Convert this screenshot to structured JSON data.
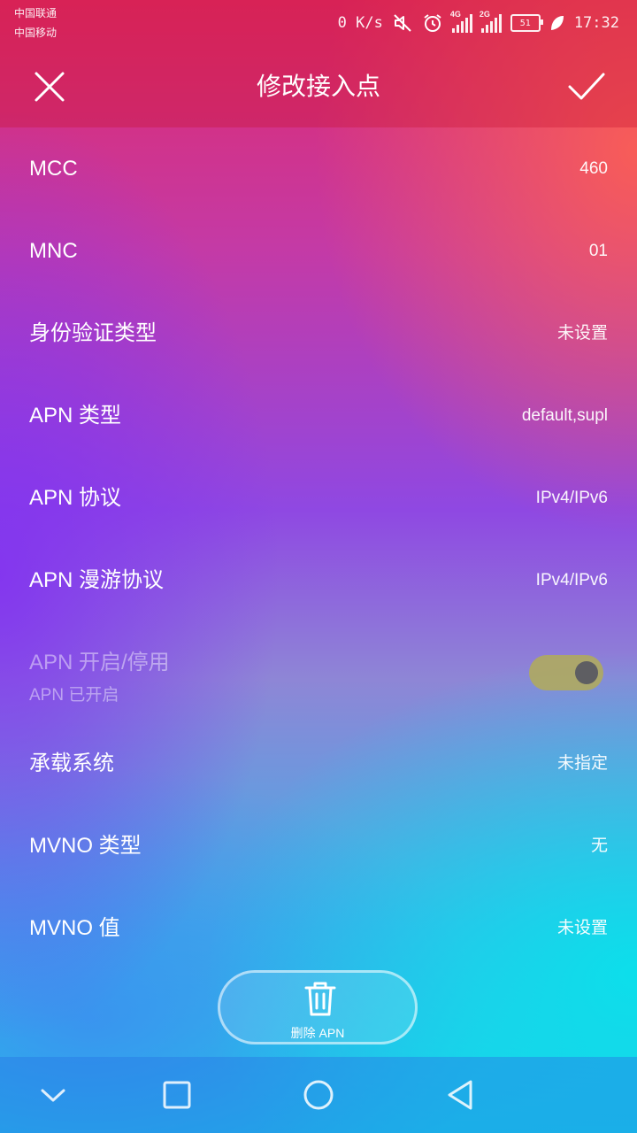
{
  "status_bar": {
    "carrier_1": "中国联通",
    "carrier_2": "中国移动",
    "net_speed": "0 K/s",
    "signal_1_type": "4G",
    "signal_2_type": "2G",
    "battery_level": "51",
    "time": "17:32",
    "icons": [
      "mute-icon",
      "alarm-icon",
      "signal-icon",
      "battery-icon",
      "leaf-icon"
    ]
  },
  "header": {
    "title": "修改接入点"
  },
  "settings": {
    "rows": [
      {
        "label": "MCC",
        "value": "460"
      },
      {
        "label": "MNC",
        "value": "01"
      },
      {
        "label": "身份验证类型",
        "value": "未设置"
      },
      {
        "label": "APN 类型",
        "value": "default,supl"
      },
      {
        "label": "APN 协议",
        "value": "IPv4/IPv6"
      },
      {
        "label": "APN 漫游协议",
        "value": "IPv4/IPv6"
      }
    ],
    "toggle": {
      "label": "APN 开启/停用",
      "sub": "APN 已开启",
      "enabled": true
    },
    "rows2": [
      {
        "label": "承载系统",
        "value": "未指定"
      },
      {
        "label": "MVNO 类型",
        "value": "无"
      },
      {
        "label": "MVNO 值",
        "value": "未设置"
      }
    ]
  },
  "delete_button": {
    "label": "删除 APN",
    "icon": "trash-icon"
  },
  "colors": {
    "top_pink": "#e02a6a",
    "mid_purple": "#8f48e2",
    "bottom_cyan": "#15d8e8",
    "toggle_track": "#afaa5f",
    "toggle_knob": "#5e5e62"
  }
}
